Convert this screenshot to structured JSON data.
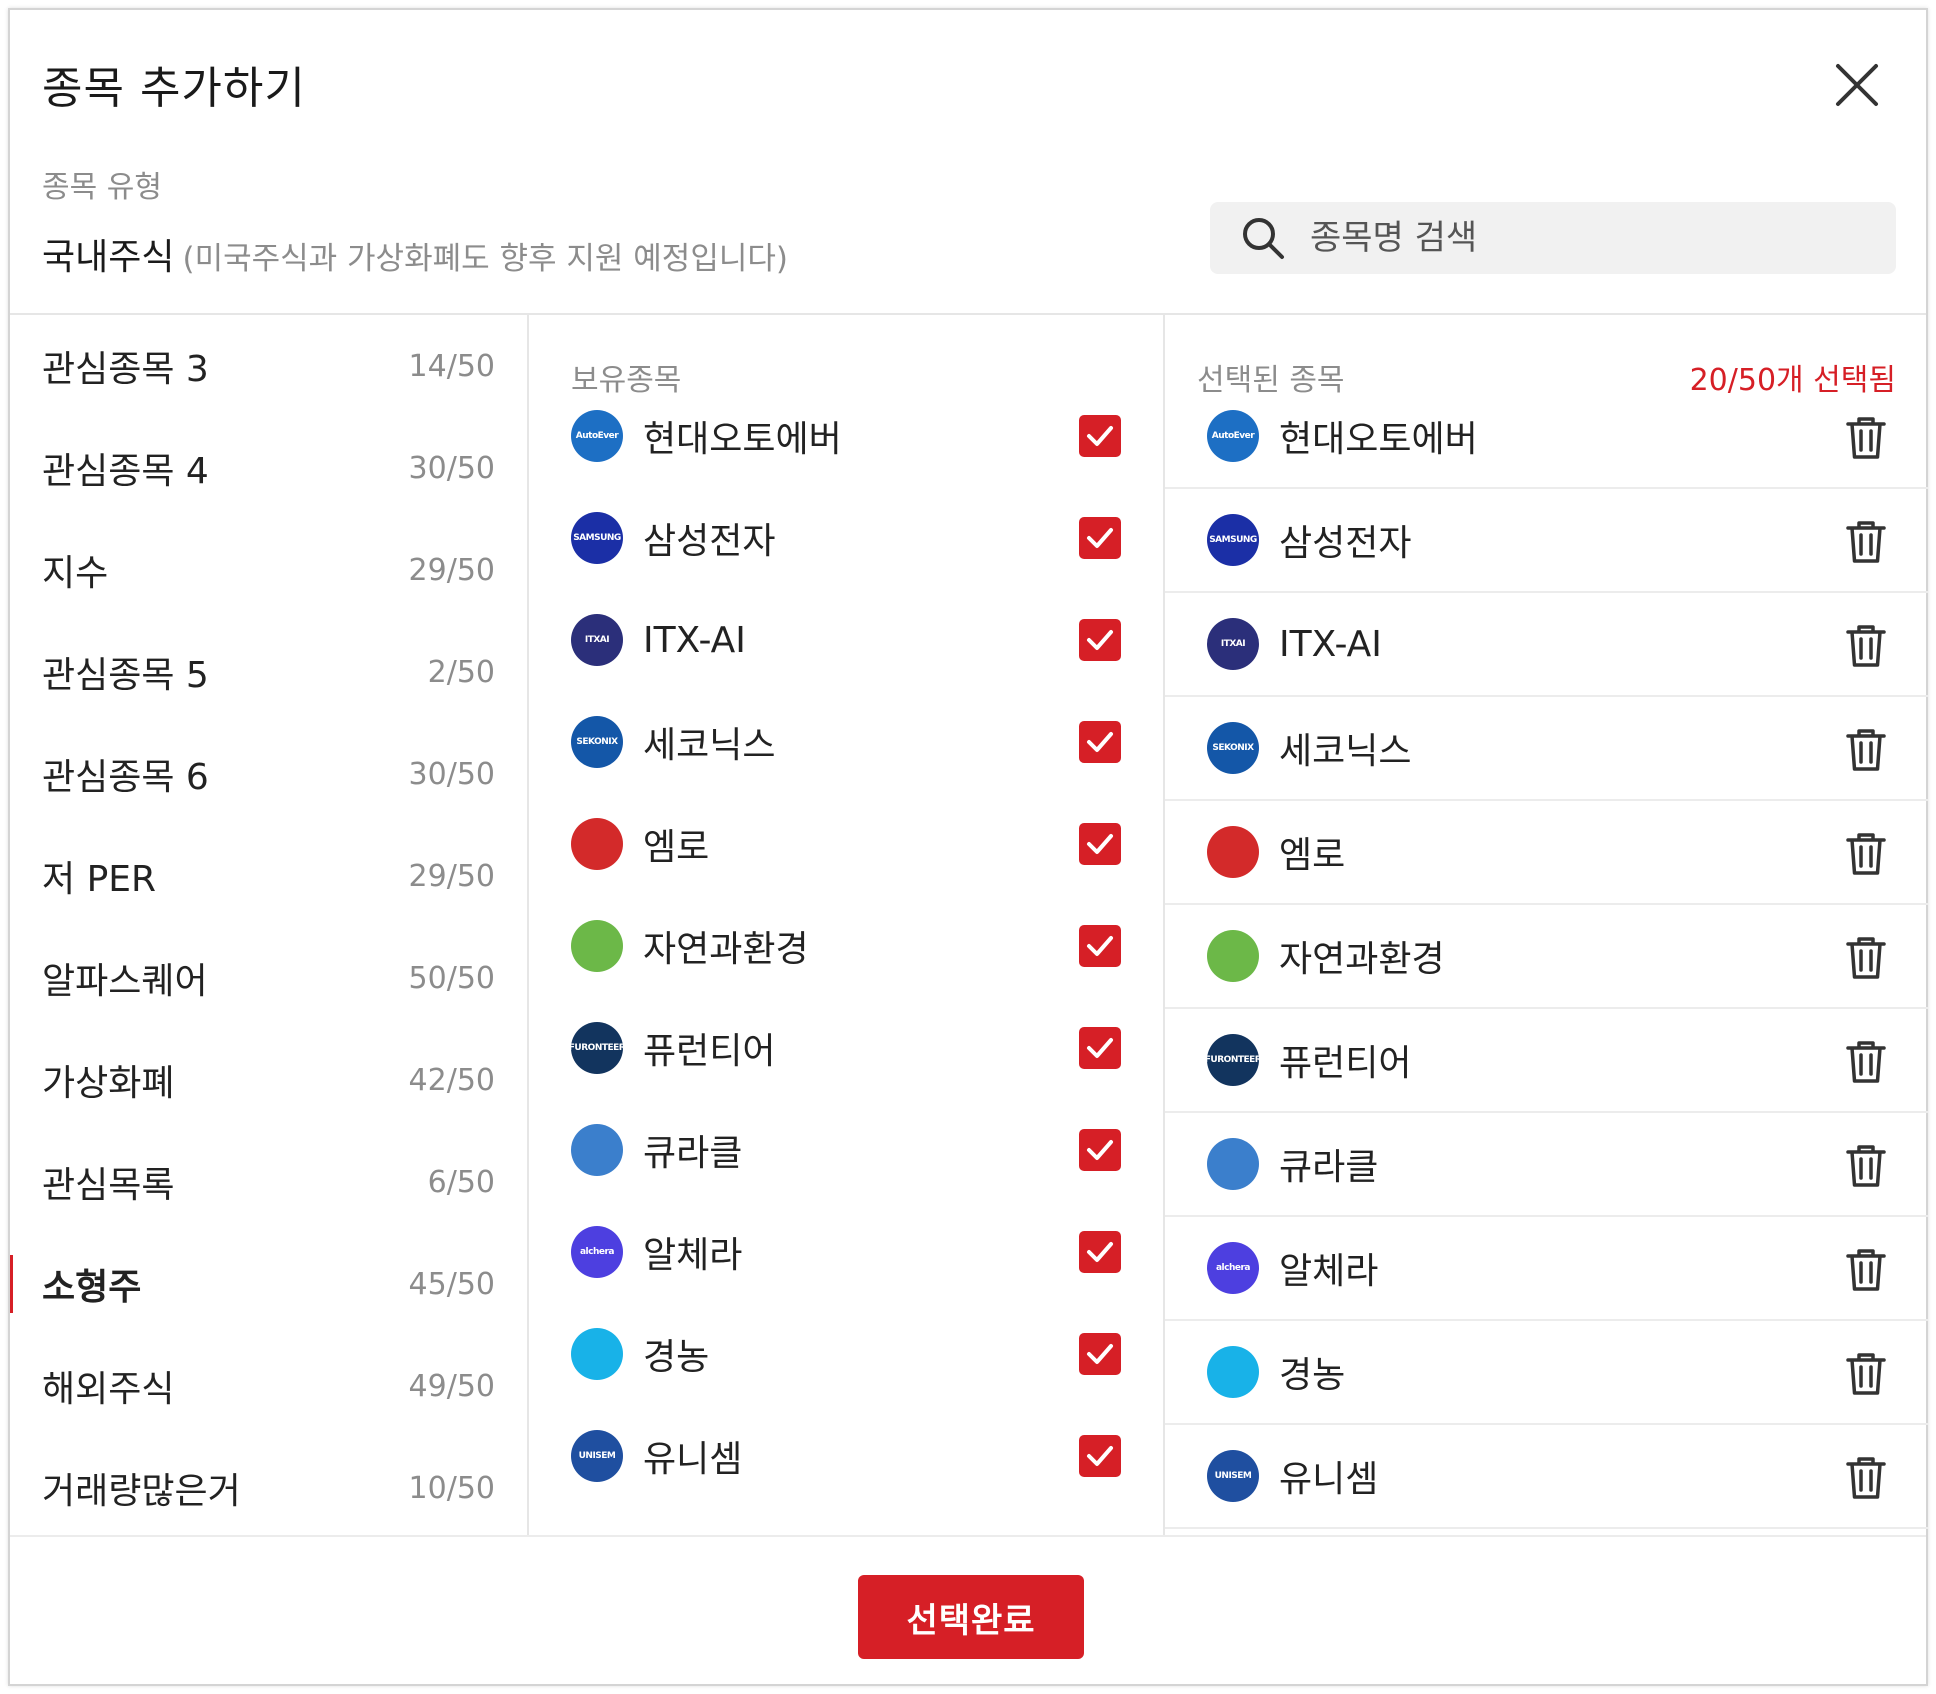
{
  "modal": {
    "title": "종목 추가하기"
  },
  "stock_type": {
    "label": "종목 유형",
    "value": "국내주식",
    "note": "(미국주식과 가상화폐도 향후 지원 예정입니다)"
  },
  "search": {
    "placeholder": "종목명 검색",
    "value": ""
  },
  "groups": [
    {
      "name": "관심종목 3",
      "count": "14/50"
    },
    {
      "name": "관심종목 4",
      "count": "30/50"
    },
    {
      "name": "지수",
      "count": "29/50"
    },
    {
      "name": "관심종목 5",
      "count": "2/50"
    },
    {
      "name": "관심종목 6",
      "count": "30/50"
    },
    {
      "name": "저 PER",
      "count": "29/50"
    },
    {
      "name": "알파스퀘어",
      "count": "50/50"
    },
    {
      "name": "가상화폐",
      "count": "42/50"
    },
    {
      "name": "관심목록",
      "count": "6/50"
    },
    {
      "name": "소형주",
      "count": "45/50",
      "active": true
    },
    {
      "name": "해외주식",
      "count": "49/50"
    },
    {
      "name": "거래량많은거",
      "count": "10/50"
    }
  ],
  "held": {
    "label": "보유종목",
    "items": [
      {
        "name": "현대오토에버",
        "checked": true,
        "logo": {
          "text": "AutoEver",
          "color": "#1d6fc4"
        }
      },
      {
        "name": "삼성전자",
        "checked": true,
        "logo": {
          "text": "SAMSUNG",
          "color": "#1b2fa6"
        }
      },
      {
        "name": "ITX-AI",
        "checked": true,
        "logo": {
          "text": "ITXAI",
          "color": "#2b2f7a"
        }
      },
      {
        "name": "세코닉스",
        "checked": true,
        "logo": {
          "text": "SEKONIX",
          "color": "#1457a8"
        }
      },
      {
        "name": "엠로",
        "checked": true,
        "logo": {
          "text": "",
          "color": "#d32a2a"
        }
      },
      {
        "name": "자연과환경",
        "checked": true,
        "logo": {
          "text": "",
          "color": "#6cb848"
        }
      },
      {
        "name": "퓨런티어",
        "checked": true,
        "logo": {
          "text": "FURONTEER",
          "color": "#12345e"
        }
      },
      {
        "name": "큐라클",
        "checked": true,
        "logo": {
          "text": "",
          "color": "#3b7fcc"
        }
      },
      {
        "name": "알체라",
        "checked": true,
        "logo": {
          "text": "alchera",
          "color": "#4d3fe0"
        }
      },
      {
        "name": "경농",
        "checked": true,
        "logo": {
          "text": "",
          "color": "#18b2e8"
        }
      },
      {
        "name": "유니셈",
        "checked": true,
        "logo": {
          "text": "UNISEM",
          "color": "#1f4fa0"
        }
      }
    ]
  },
  "selected": {
    "label": "선택된 종목",
    "count_text": "20/50개 선택됨",
    "items": [
      "현대오토에버",
      "삼성전자",
      "ITX-AI",
      "세코닉스",
      "엠로",
      "자연과환경",
      "퓨런티어",
      "큐라클",
      "알체라",
      "경농",
      "유니셈"
    ]
  },
  "footer": {
    "done_label": "선택완료"
  },
  "colors": {
    "accent": "#d61f26",
    "muted": "#8c8c8c",
    "divider": "#e6e6e6"
  }
}
